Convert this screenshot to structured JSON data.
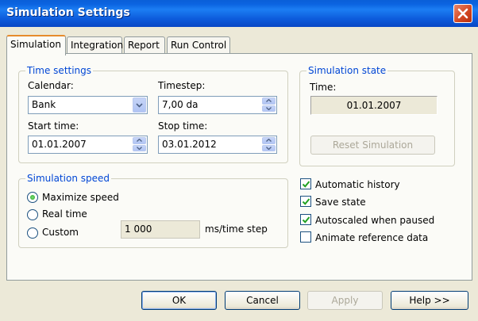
{
  "window": {
    "title": "Simulation Settings"
  },
  "tabs": [
    {
      "label": "Simulation",
      "active": true
    },
    {
      "label": "Integration",
      "active": false
    },
    {
      "label": "Report",
      "active": false
    },
    {
      "label": "Run Control",
      "active": false
    }
  ],
  "time_settings": {
    "group_label": "Time settings",
    "calendar_label": "Calendar:",
    "calendar_value": "Bank",
    "timestep_label": "Timestep:",
    "timestep_value": "7,00 da",
    "start_label": "Start time:",
    "start_value": "01.01.2007",
    "stop_label": "Stop time:",
    "stop_value": "03.01.2012"
  },
  "simulation_state": {
    "group_label": "Simulation state",
    "time_label": "Time:",
    "time_value": "01.01.2007",
    "reset_button": "Reset Simulation"
  },
  "simulation_speed": {
    "group_label": "Simulation speed",
    "options": [
      {
        "label": "Maximize speed",
        "selected": true
      },
      {
        "label": "Real time",
        "selected": false
      },
      {
        "label": "Custom",
        "selected": false
      }
    ],
    "custom_value": "1 000",
    "custom_unit": "ms/time step"
  },
  "options": [
    {
      "label": "Automatic history",
      "checked": true
    },
    {
      "label": "Save state",
      "checked": true
    },
    {
      "label": "Autoscaled when paused",
      "checked": true
    },
    {
      "label": "Animate reference data",
      "checked": false
    }
  ],
  "buttons": {
    "ok": "OK",
    "cancel": "Cancel",
    "apply": "Apply",
    "help": "Help >>"
  }
}
